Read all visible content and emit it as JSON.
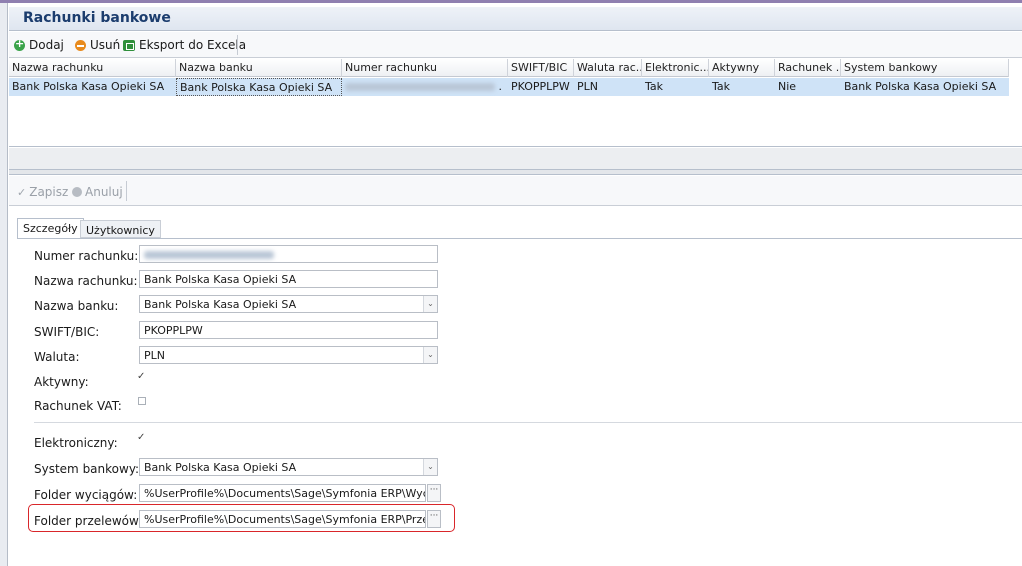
{
  "header": {
    "title": "Rachunki bankowe"
  },
  "toolbar": {
    "add_label": "Dodaj",
    "delete_label": "Usuń",
    "export_label": "Eksport do Excela"
  },
  "grid": {
    "columns": [
      "Nazwa rachunku",
      "Nazwa banku",
      "Numer rachunku",
      "SWIFT/BIC",
      "Waluta rac...",
      "Elektronic...",
      "Aktywny",
      "Rachunek ...",
      "System bankowy"
    ],
    "rows": [
      {
        "nazwa_rachunku": "Bank Polska Kasa Opieki SA",
        "nazwa_banku": "Bank Polska Kasa Opieki SA",
        "numer_rachunku_suffix": ".",
        "swift": "PKOPPLPW",
        "waluta": "PLN",
        "elektroniczny": "Tak",
        "aktywny": "Tak",
        "rachunek_vat": "Nie",
        "system_bankowy": "Bank Polska Kasa Opieki SA"
      }
    ]
  },
  "edit_toolbar": {
    "save_label": "Zapisz",
    "cancel_label": "Anuluj"
  },
  "tabs": [
    {
      "label": "Szczegóły"
    },
    {
      "label": "Użytkownicy"
    }
  ],
  "form": {
    "numer_rachunku_label": "Numer rachunku:",
    "nazwa_rachunku_label": "Nazwa rachunku:",
    "nazwa_rachunku_value": "Bank Polska Kasa Opieki SA",
    "nazwa_banku_label": "Nazwa banku:",
    "nazwa_banku_value": "Bank Polska Kasa Opieki SA",
    "swift_label": "SWIFT/BIC:",
    "swift_value": "PKOPPLPW",
    "waluta_label": "Waluta:",
    "waluta_value": "PLN",
    "aktywny_label": "Aktywny:",
    "aktywny_checked": true,
    "rachunek_vat_label": "Rachunek VAT:",
    "rachunek_vat_checked": false,
    "elektroniczny_label": "Elektroniczny:",
    "elektroniczny_checked": true,
    "system_bankowy_label": "System bankowy:",
    "system_bankowy_value": "Bank Polska Kasa Opieki SA",
    "folder_wyciagow_label": "Folder wyciągów:",
    "folder_wyciagow_value": "%UserProfile%\\Documents\\Sage\\Symfonia ERP\\Wyciągi\\%",
    "folder_przelewow_label": "Folder przelewów:",
    "folder_przelewow_value": "%UserProfile%\\Documents\\Sage\\Symfonia ERP\\Przelewy\\%",
    "ellipsis": "···",
    "check_glyph": "✓",
    "combo_glyph": "⌄"
  },
  "colors": {
    "highlight": "#d9262a",
    "selected_row": "#cfe3f7",
    "title_text": "#1c3d6e"
  }
}
